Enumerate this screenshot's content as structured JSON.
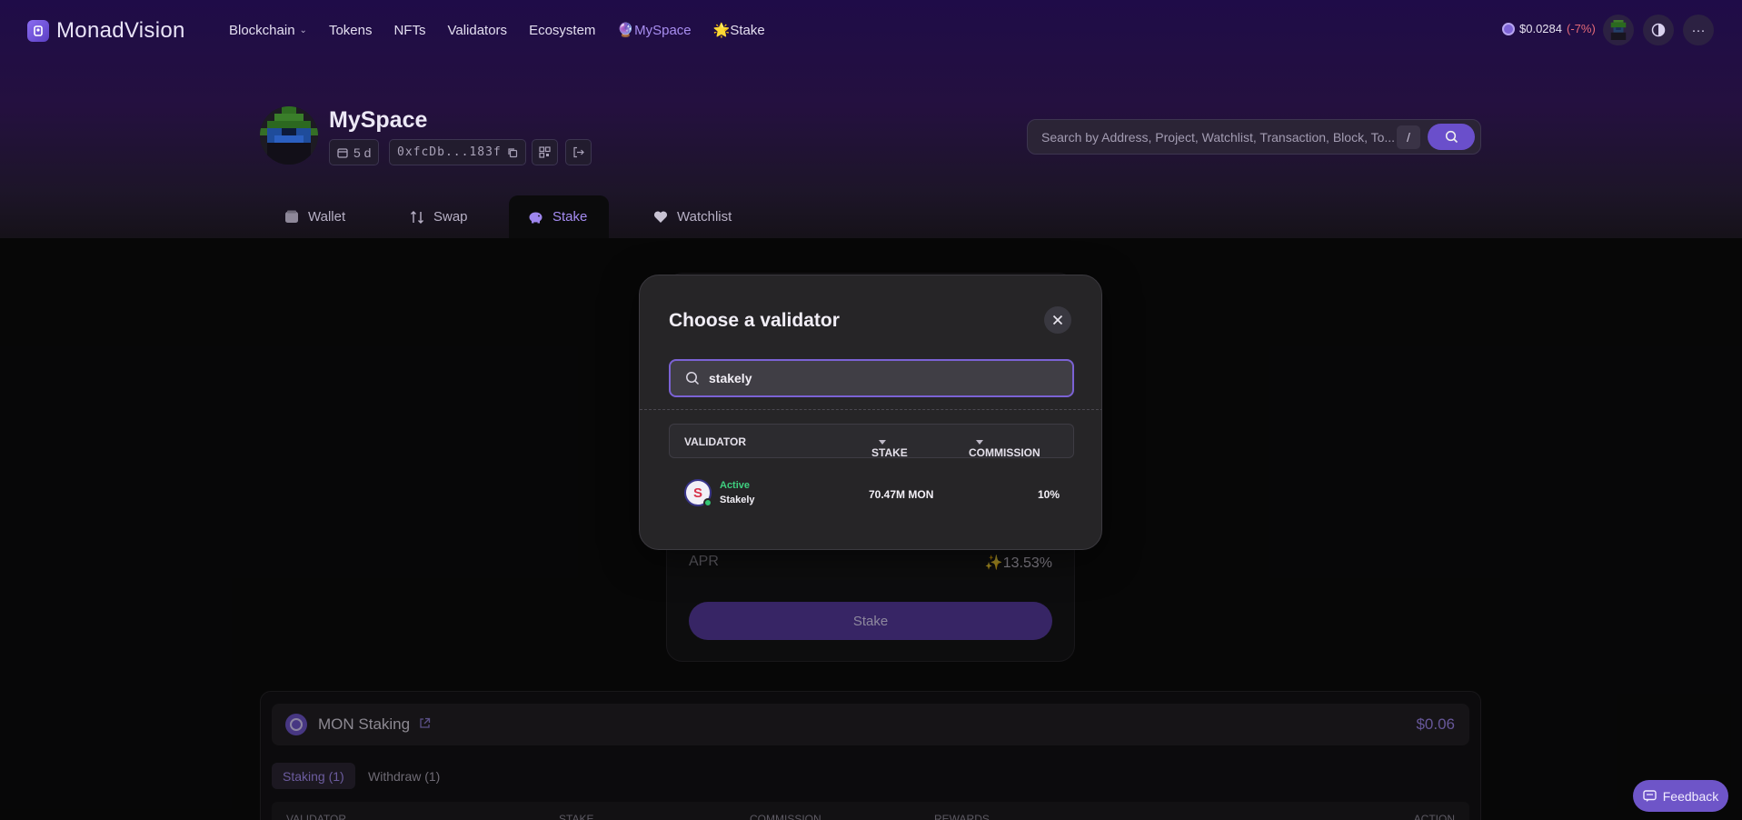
{
  "app": {
    "name": "MonadVision"
  },
  "nav": {
    "blockchain": "Blockchain",
    "tokens": "Tokens",
    "nfts": "NFTs",
    "validators": "Validators",
    "ecosystem": "Ecosystem",
    "myspace": "🔮MySpace",
    "stake": "🌟Stake"
  },
  "price": {
    "value": "$0.0284",
    "change": "(-7%)"
  },
  "profile": {
    "title": "MySpace",
    "age": "5 d",
    "address": "0xfcDb...183f"
  },
  "search": {
    "placeholder": "Search by Address, Project, Watchlist, Transaction, Block, To...",
    "shortcut": "/"
  },
  "tabs": {
    "wallet": "Wallet",
    "swap": "Swap",
    "stake": "Stake",
    "watchlist": "Watchlist"
  },
  "stake_card": {
    "apr_label": "APR",
    "apr_value": "✨13.53%",
    "button": "Stake"
  },
  "staking_panel": {
    "title": "MON Staking",
    "value": "$0.06",
    "subtabs": {
      "staking": "Staking (1)",
      "withdraw": "Withdraw (1)"
    },
    "columns": {
      "validator": "VALIDATOR",
      "stake": "STAKE",
      "commission": "COMMISSION",
      "rewards": "REWARDS",
      "action": "ACTION"
    }
  },
  "modal": {
    "title": "Choose a validator",
    "search_value": "stakely",
    "columns": {
      "validator": "VALIDATOR",
      "stake": "STAKE",
      "commission": "COMMISSION"
    },
    "rows": [
      {
        "status": "Active",
        "name": "Stakely",
        "stake": "70.47M MON",
        "commission": "10%"
      }
    ]
  },
  "feedback": {
    "label": "Feedback"
  },
  "colors": {
    "accent": "#6e55c8",
    "active_green": "#3fcf7f",
    "negative": "#e46a78"
  }
}
